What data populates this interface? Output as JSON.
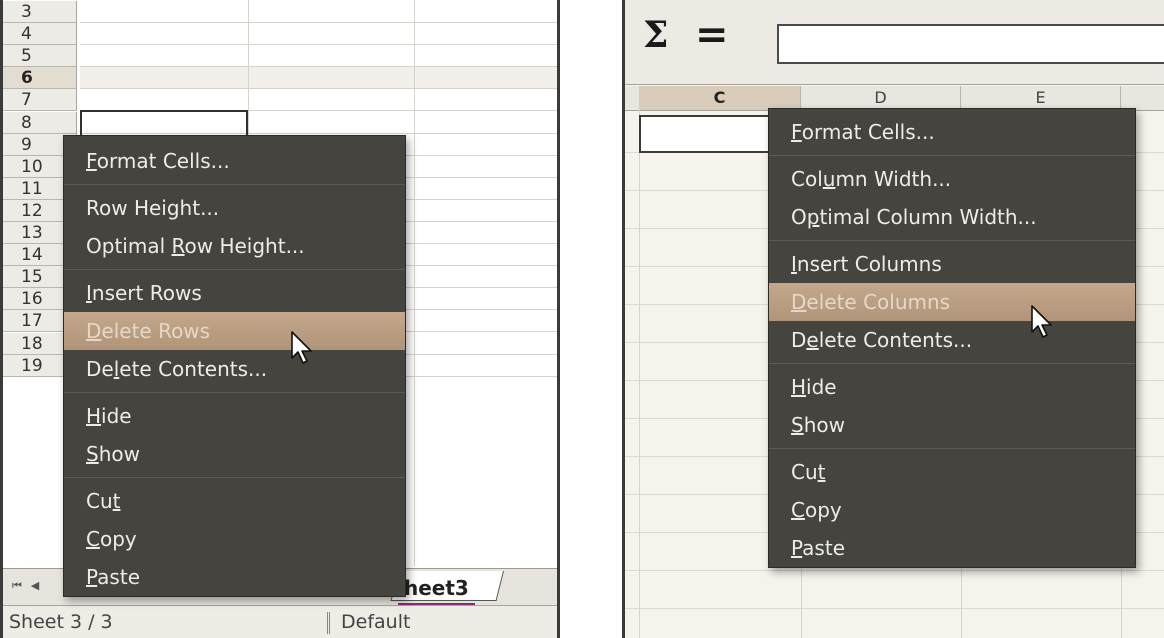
{
  "left": {
    "row_numbers": [
      "3",
      "4",
      "5",
      "6",
      "7",
      "8",
      "9",
      "10",
      "11",
      "12",
      "13",
      "14",
      "15",
      "16",
      "17",
      "18",
      "19"
    ],
    "active_row": "6",
    "sheet_tab": "heet3",
    "status": {
      "sheet": "Sheet 3 / 3",
      "style": "Default"
    },
    "nav_buttons": [
      "⏮",
      "◀"
    ],
    "menu": {
      "groups": [
        [
          {
            "pre": "",
            "mn": "F",
            "post": "ormat Cells..."
          }
        ],
        [
          {
            "pre": "Row Height...",
            "mn": "",
            "post": ""
          },
          {
            "pre": "Optimal ",
            "mn": "R",
            "post": "ow Height..."
          }
        ],
        [
          {
            "pre": "",
            "mn": "I",
            "post": "nsert Rows"
          },
          {
            "pre": "",
            "mn": "D",
            "post": "elete Rows",
            "hover": true
          },
          {
            "pre": "De",
            "mn": "l",
            "post": "ete Contents..."
          }
        ],
        [
          {
            "pre": "",
            "mn": "H",
            "post": "ide"
          },
          {
            "pre": "",
            "mn": "S",
            "post": "how"
          }
        ],
        [
          {
            "pre": "Cu",
            "mn": "t",
            "post": ""
          },
          {
            "pre": "",
            "mn": "C",
            "post": "opy"
          },
          {
            "pre": "",
            "mn": "P",
            "post": "aste"
          }
        ]
      ]
    }
  },
  "right": {
    "formula": {
      "sigma": "Σ",
      "equals": "="
    },
    "columns": [
      "C",
      "D",
      "E"
    ],
    "active_column": "C",
    "menu": {
      "groups": [
        [
          {
            "pre": "",
            "mn": "F",
            "post": "ormat Cells..."
          }
        ],
        [
          {
            "pre": "Col",
            "mn": "u",
            "post": "mn Width..."
          },
          {
            "pre": "O",
            "mn": "p",
            "post": "timal Column Width..."
          }
        ],
        [
          {
            "pre": "",
            "mn": "I",
            "post": "nsert Columns"
          },
          {
            "pre": "",
            "mn": "D",
            "post": "elete Columns",
            "hover": true
          },
          {
            "pre": "D",
            "mn": "e",
            "post": "lete Contents..."
          }
        ],
        [
          {
            "pre": "",
            "mn": "H",
            "post": "ide"
          },
          {
            "pre": "",
            "mn": "S",
            "post": "how"
          }
        ],
        [
          {
            "pre": "Cu",
            "mn": "t",
            "post": ""
          },
          {
            "pre": "",
            "mn": "C",
            "post": "opy"
          },
          {
            "pre": "",
            "mn": "P",
            "post": "aste"
          }
        ]
      ]
    }
  }
}
